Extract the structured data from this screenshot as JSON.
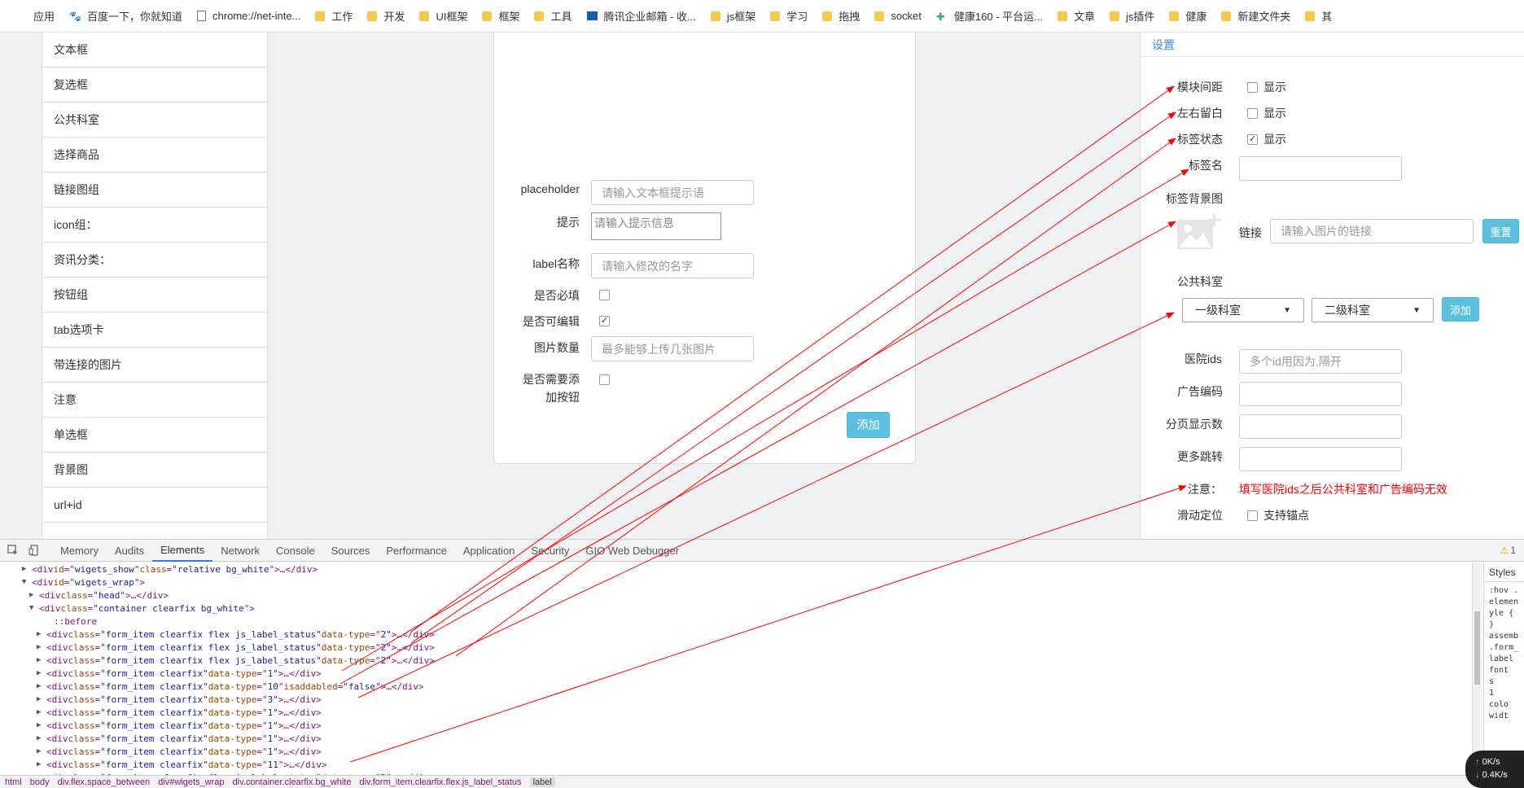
{
  "bookmarks": [
    {
      "label": "应用",
      "icon": "apps-grid-icon"
    },
    {
      "label": "百度一下，你就知道",
      "icon": "baidu-paw-icon"
    },
    {
      "label": "chrome://net-inte...",
      "icon": "page-icon"
    },
    {
      "label": "工作",
      "icon": "folder-icon"
    },
    {
      "label": "开发",
      "icon": "folder-icon"
    },
    {
      "label": "UI框架",
      "icon": "folder-icon"
    },
    {
      "label": "框架",
      "icon": "folder-icon"
    },
    {
      "label": "工具",
      "icon": "folder-icon"
    },
    {
      "label": "腾讯企业邮箱 - 收...",
      "icon": "mail-icon"
    },
    {
      "label": "js框架",
      "icon": "folder-icon"
    },
    {
      "label": "学习",
      "icon": "folder-icon"
    },
    {
      "label": "拖拽",
      "icon": "folder-icon"
    },
    {
      "label": "socket",
      "icon": "folder-icon"
    },
    {
      "label": "健康160 - 平台运...",
      "icon": "health-icon"
    },
    {
      "label": "文章",
      "icon": "folder-icon"
    },
    {
      "label": "js插件",
      "icon": "folder-icon"
    },
    {
      "label": "健康",
      "icon": "folder-icon"
    },
    {
      "label": "新建文件夹",
      "icon": "folder-icon"
    },
    {
      "label": "其",
      "icon": "folder-icon"
    }
  ],
  "left_list": [
    "文本框",
    "复选框",
    "公共科室",
    "选择商品",
    "链接图组",
    "icon组：",
    "资讯分类：",
    "按钮组",
    "tab选项卡",
    "带连接的图片",
    "注意",
    "单选框",
    "背景图",
    "url+id"
  ],
  "middle_form": {
    "placeholder_label": "placeholder",
    "placeholder_input": "请输入文本框提示语",
    "hint_label": "提示",
    "hint_input": "请输入提示信息",
    "label_name_label": "label名称",
    "label_name_input": "请输入修改的名字",
    "required_label": "是否必填",
    "required_checked": false,
    "editable_label": "是否可编辑",
    "editable_checked": true,
    "image_count_label": "图片数量",
    "image_count_input": "最多能够上传几张图片",
    "add_button_label_1": "是否需要添",
    "add_button_label_2": "加按钮",
    "add_button_checked": false,
    "add_button": "添加"
  },
  "settings": {
    "title": "设置",
    "module_spacing_label": "模块间距",
    "module_spacing_option": "显示",
    "module_spacing_checked": false,
    "lr_margin_label": "左右留白",
    "lr_margin_option": "显示",
    "lr_margin_checked": false,
    "tag_status_label": "标签状态",
    "tag_status_option": "显示",
    "tag_status_checked": true,
    "tag_name_label": "标签名",
    "tag_bg_label": "标签背景图",
    "link_label": "链接",
    "link_placeholder": "请输入图片的链接",
    "reset_button": "重置",
    "department_label": "公共科室",
    "dept_level1": "一级科室",
    "dept_level2": "二级科室",
    "dept_add_button": "添加",
    "hospital_ids_label": "医院ids",
    "hospital_ids_placeholder": "多个id用因为,隔开",
    "ad_code_label": "广告编码",
    "page_size_label": "分页显示数",
    "more_jump_label": "更多跳转",
    "note_label": "注意：",
    "note_text": "填写医院ids之后公共科室和广告编码无效",
    "scroll_label": "滑动定位",
    "scroll_option": "支持锚点",
    "scroll_checked": false
  },
  "devtools": {
    "tabs": [
      "Memory",
      "Audits",
      "Elements",
      "Network",
      "Console",
      "Sources",
      "Performance",
      "Application",
      "Security",
      "GIO Web Debugger"
    ],
    "active_tab": "Elements",
    "warning_count": "1",
    "styles_tab": "Styles",
    "styles_lines": [
      ":hov .",
      "element",
      "yle {",
      "}",
      "assembl",
      ".form_i",
      "label {",
      "font",
      "s",
      "1",
      "colo",
      "widt"
    ],
    "dom_lines": [
      {
        "indent": 3,
        "tri": "▶",
        "tag": "div",
        "attrs": [
          [
            "id",
            "wigets_show"
          ],
          [
            "class",
            "relative bg_white"
          ]
        ],
        "tail": "…</div>"
      },
      {
        "indent": 3,
        "tri": "▼",
        "tag": "div",
        "attrs": [
          [
            "id",
            "wigets_wrap"
          ]
        ],
        "tail": ""
      },
      {
        "indent": 4,
        "tri": "▶",
        "tag": "div",
        "attrs": [
          [
            "class",
            "head"
          ]
        ],
        "tail": "…</div>"
      },
      {
        "indent": 4,
        "tri": "▼",
        "tag": "div",
        "attrs": [
          [
            "class",
            "container clearfix bg_white"
          ]
        ],
        "tail": ""
      },
      {
        "indent": 6,
        "tri": "",
        "pseudo": "::before"
      },
      {
        "indent": 5,
        "tri": "▶",
        "tag": "div",
        "attrs": [
          [
            "class",
            "form_item clearfix flex js_label_status"
          ],
          [
            "data-type",
            "2"
          ]
        ],
        "tail": "…</div>"
      },
      {
        "indent": 5,
        "tri": "▶",
        "tag": "div",
        "attrs": [
          [
            "class",
            "form_item clearfix flex js_label_status"
          ],
          [
            "data-type",
            "2"
          ]
        ],
        "tail": "…</div>"
      },
      {
        "indent": 5,
        "tri": "▶",
        "tag": "div",
        "attrs": [
          [
            "class",
            "form_item clearfix flex js_label_status"
          ],
          [
            "data-type",
            "2"
          ]
        ],
        "tail": "…</div>"
      },
      {
        "indent": 5,
        "tri": "▶",
        "tag": "div",
        "attrs": [
          [
            "class",
            "form_item clearfix"
          ],
          [
            "data-type",
            "1"
          ]
        ],
        "tail": "…</div>"
      },
      {
        "indent": 5,
        "tri": "▶",
        "tag": "div",
        "attrs": [
          [
            "class",
            "form_item clearfix"
          ],
          [
            "data-type",
            "10"
          ],
          [
            "isaddabled",
            "false"
          ]
        ],
        "tail": "…</div>"
      },
      {
        "indent": 5,
        "tri": "▶",
        "tag": "div",
        "attrs": [
          [
            "class",
            "form_item clearfix"
          ],
          [
            "data-type",
            "3"
          ]
        ],
        "tail": "…</div>"
      },
      {
        "indent": 5,
        "tri": "▶",
        "tag": "div",
        "attrs": [
          [
            "class",
            "form_item clearfix"
          ],
          [
            "data-type",
            "1"
          ]
        ],
        "tail": "…</div>"
      },
      {
        "indent": 5,
        "tri": "▶",
        "tag": "div",
        "attrs": [
          [
            "class",
            "form_item clearfix"
          ],
          [
            "data-type",
            "1"
          ]
        ],
        "tail": "…</div>"
      },
      {
        "indent": 5,
        "tri": "▶",
        "tag": "div",
        "attrs": [
          [
            "class",
            "form_item clearfix"
          ],
          [
            "data-type",
            "1"
          ]
        ],
        "tail": "…</div>"
      },
      {
        "indent": 5,
        "tri": "▶",
        "tag": "div",
        "attrs": [
          [
            "class",
            "form_item clearfix"
          ],
          [
            "data-type",
            "1"
          ]
        ],
        "tail": "…</div>"
      },
      {
        "indent": 5,
        "tri": "▶",
        "tag": "div",
        "attrs": [
          [
            "class",
            "form_item clearfix"
          ],
          [
            "data-type",
            "11"
          ]
        ],
        "tail": "…</div>"
      },
      {
        "indent": 5,
        "tri": "▶",
        "tag": "div",
        "attrs": [
          [
            "class",
            "form_item clearfix flex js_label_status"
          ],
          [
            "data-type",
            "2"
          ]
        ],
        "tail": "…</div>"
      }
    ],
    "breadcrumbs": [
      "html",
      "body",
      "div.flex.space_between",
      "div#wigets_wrap",
      "div.container.clearfix.bg_white",
      "div.form_item.clearfix.flex.js_label_status",
      "label"
    ],
    "net_up": "0K/s",
    "net_down": "0.4K/s"
  },
  "colors": {
    "accent_blue": "#5bc0de",
    "settings_title": "#4a86c5",
    "annotation_red": "#ff0000",
    "note_red": "#ff0000"
  }
}
